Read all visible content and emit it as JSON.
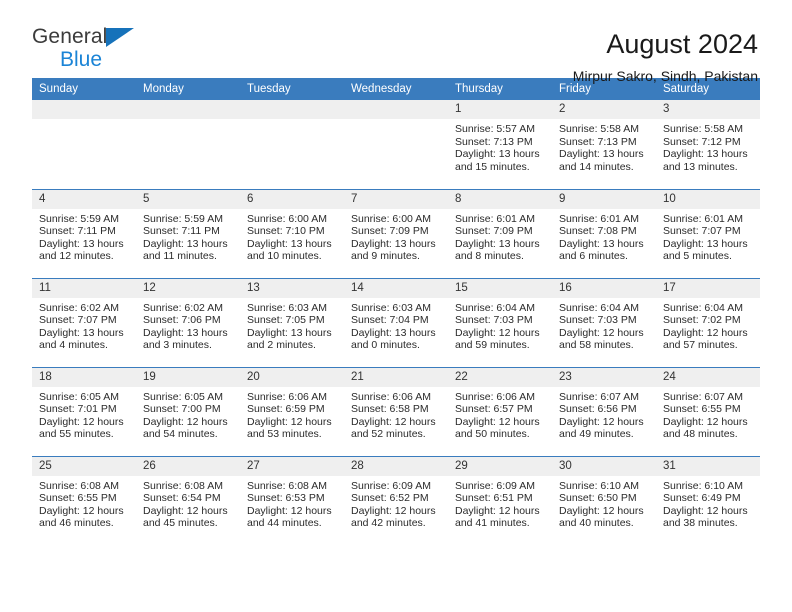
{
  "brand": {
    "name_top": "General",
    "name_bottom": "Blue",
    "accent_color": "#1672BA"
  },
  "header": {
    "title": "August 2024",
    "subtitle": "Mirpur Sakro, Sindh, Pakistan"
  },
  "theme": {
    "header_blue": "#3A7CBE",
    "daynum_gray": "#EFEFEF"
  },
  "weekday_headers": [
    "Sunday",
    "Monday",
    "Tuesday",
    "Wednesday",
    "Thursday",
    "Friday",
    "Saturday"
  ],
  "labels": {
    "sunrise_prefix": "Sunrise:",
    "sunset_prefix": "Sunset:",
    "daylight_prefix": "Daylight:"
  },
  "weeks": [
    [
      {
        "day": "",
        "blank": true
      },
      {
        "day": "",
        "blank": true
      },
      {
        "day": "",
        "blank": true
      },
      {
        "day": "",
        "blank": true
      },
      {
        "day": "1",
        "sunrise": "Sunrise: 5:57 AM",
        "sunset": "Sunset: 7:13 PM",
        "daylight": "Daylight: 13 hours and 15 minutes."
      },
      {
        "day": "2",
        "sunrise": "Sunrise: 5:58 AM",
        "sunset": "Sunset: 7:13 PM",
        "daylight": "Daylight: 13 hours and 14 minutes."
      },
      {
        "day": "3",
        "sunrise": "Sunrise: 5:58 AM",
        "sunset": "Sunset: 7:12 PM",
        "daylight": "Daylight: 13 hours and 13 minutes."
      }
    ],
    [
      {
        "day": "4",
        "sunrise": "Sunrise: 5:59 AM",
        "sunset": "Sunset: 7:11 PM",
        "daylight": "Daylight: 13 hours and 12 minutes."
      },
      {
        "day": "5",
        "sunrise": "Sunrise: 5:59 AM",
        "sunset": "Sunset: 7:11 PM",
        "daylight": "Daylight: 13 hours and 11 minutes."
      },
      {
        "day": "6",
        "sunrise": "Sunrise: 6:00 AM",
        "sunset": "Sunset: 7:10 PM",
        "daylight": "Daylight: 13 hours and 10 minutes."
      },
      {
        "day": "7",
        "sunrise": "Sunrise: 6:00 AM",
        "sunset": "Sunset: 7:09 PM",
        "daylight": "Daylight: 13 hours and 9 minutes."
      },
      {
        "day": "8",
        "sunrise": "Sunrise: 6:01 AM",
        "sunset": "Sunset: 7:09 PM",
        "daylight": "Daylight: 13 hours and 8 minutes."
      },
      {
        "day": "9",
        "sunrise": "Sunrise: 6:01 AM",
        "sunset": "Sunset: 7:08 PM",
        "daylight": "Daylight: 13 hours and 6 minutes."
      },
      {
        "day": "10",
        "sunrise": "Sunrise: 6:01 AM",
        "sunset": "Sunset: 7:07 PM",
        "daylight": "Daylight: 13 hours and 5 minutes."
      }
    ],
    [
      {
        "day": "11",
        "sunrise": "Sunrise: 6:02 AM",
        "sunset": "Sunset: 7:07 PM",
        "daylight": "Daylight: 13 hours and 4 minutes."
      },
      {
        "day": "12",
        "sunrise": "Sunrise: 6:02 AM",
        "sunset": "Sunset: 7:06 PM",
        "daylight": "Daylight: 13 hours and 3 minutes."
      },
      {
        "day": "13",
        "sunrise": "Sunrise: 6:03 AM",
        "sunset": "Sunset: 7:05 PM",
        "daylight": "Daylight: 13 hours and 2 minutes."
      },
      {
        "day": "14",
        "sunrise": "Sunrise: 6:03 AM",
        "sunset": "Sunset: 7:04 PM",
        "daylight": "Daylight: 13 hours and 0 minutes."
      },
      {
        "day": "15",
        "sunrise": "Sunrise: 6:04 AM",
        "sunset": "Sunset: 7:03 PM",
        "daylight": "Daylight: 12 hours and 59 minutes."
      },
      {
        "day": "16",
        "sunrise": "Sunrise: 6:04 AM",
        "sunset": "Sunset: 7:03 PM",
        "daylight": "Daylight: 12 hours and 58 minutes."
      },
      {
        "day": "17",
        "sunrise": "Sunrise: 6:04 AM",
        "sunset": "Sunset: 7:02 PM",
        "daylight": "Daylight: 12 hours and 57 minutes."
      }
    ],
    [
      {
        "day": "18",
        "sunrise": "Sunrise: 6:05 AM",
        "sunset": "Sunset: 7:01 PM",
        "daylight": "Daylight: 12 hours and 55 minutes."
      },
      {
        "day": "19",
        "sunrise": "Sunrise: 6:05 AM",
        "sunset": "Sunset: 7:00 PM",
        "daylight": "Daylight: 12 hours and 54 minutes."
      },
      {
        "day": "20",
        "sunrise": "Sunrise: 6:06 AM",
        "sunset": "Sunset: 6:59 PM",
        "daylight": "Daylight: 12 hours and 53 minutes."
      },
      {
        "day": "21",
        "sunrise": "Sunrise: 6:06 AM",
        "sunset": "Sunset: 6:58 PM",
        "daylight": "Daylight: 12 hours and 52 minutes."
      },
      {
        "day": "22",
        "sunrise": "Sunrise: 6:06 AM",
        "sunset": "Sunset: 6:57 PM",
        "daylight": "Daylight: 12 hours and 50 minutes."
      },
      {
        "day": "23",
        "sunrise": "Sunrise: 6:07 AM",
        "sunset": "Sunset: 6:56 PM",
        "daylight": "Daylight: 12 hours and 49 minutes."
      },
      {
        "day": "24",
        "sunrise": "Sunrise: 6:07 AM",
        "sunset": "Sunset: 6:55 PM",
        "daylight": "Daylight: 12 hours and 48 minutes."
      }
    ],
    [
      {
        "day": "25",
        "sunrise": "Sunrise: 6:08 AM",
        "sunset": "Sunset: 6:55 PM",
        "daylight": "Daylight: 12 hours and 46 minutes."
      },
      {
        "day": "26",
        "sunrise": "Sunrise: 6:08 AM",
        "sunset": "Sunset: 6:54 PM",
        "daylight": "Daylight: 12 hours and 45 minutes."
      },
      {
        "day": "27",
        "sunrise": "Sunrise: 6:08 AM",
        "sunset": "Sunset: 6:53 PM",
        "daylight": "Daylight: 12 hours and 44 minutes."
      },
      {
        "day": "28",
        "sunrise": "Sunrise: 6:09 AM",
        "sunset": "Sunset: 6:52 PM",
        "daylight": "Daylight: 12 hours and 42 minutes."
      },
      {
        "day": "29",
        "sunrise": "Sunrise: 6:09 AM",
        "sunset": "Sunset: 6:51 PM",
        "daylight": "Daylight: 12 hours and 41 minutes."
      },
      {
        "day": "30",
        "sunrise": "Sunrise: 6:10 AM",
        "sunset": "Sunset: 6:50 PM",
        "daylight": "Daylight: 12 hours and 40 minutes."
      },
      {
        "day": "31",
        "sunrise": "Sunrise: 6:10 AM",
        "sunset": "Sunset: 6:49 PM",
        "daylight": "Daylight: 12 hours and 38 minutes."
      }
    ]
  ]
}
